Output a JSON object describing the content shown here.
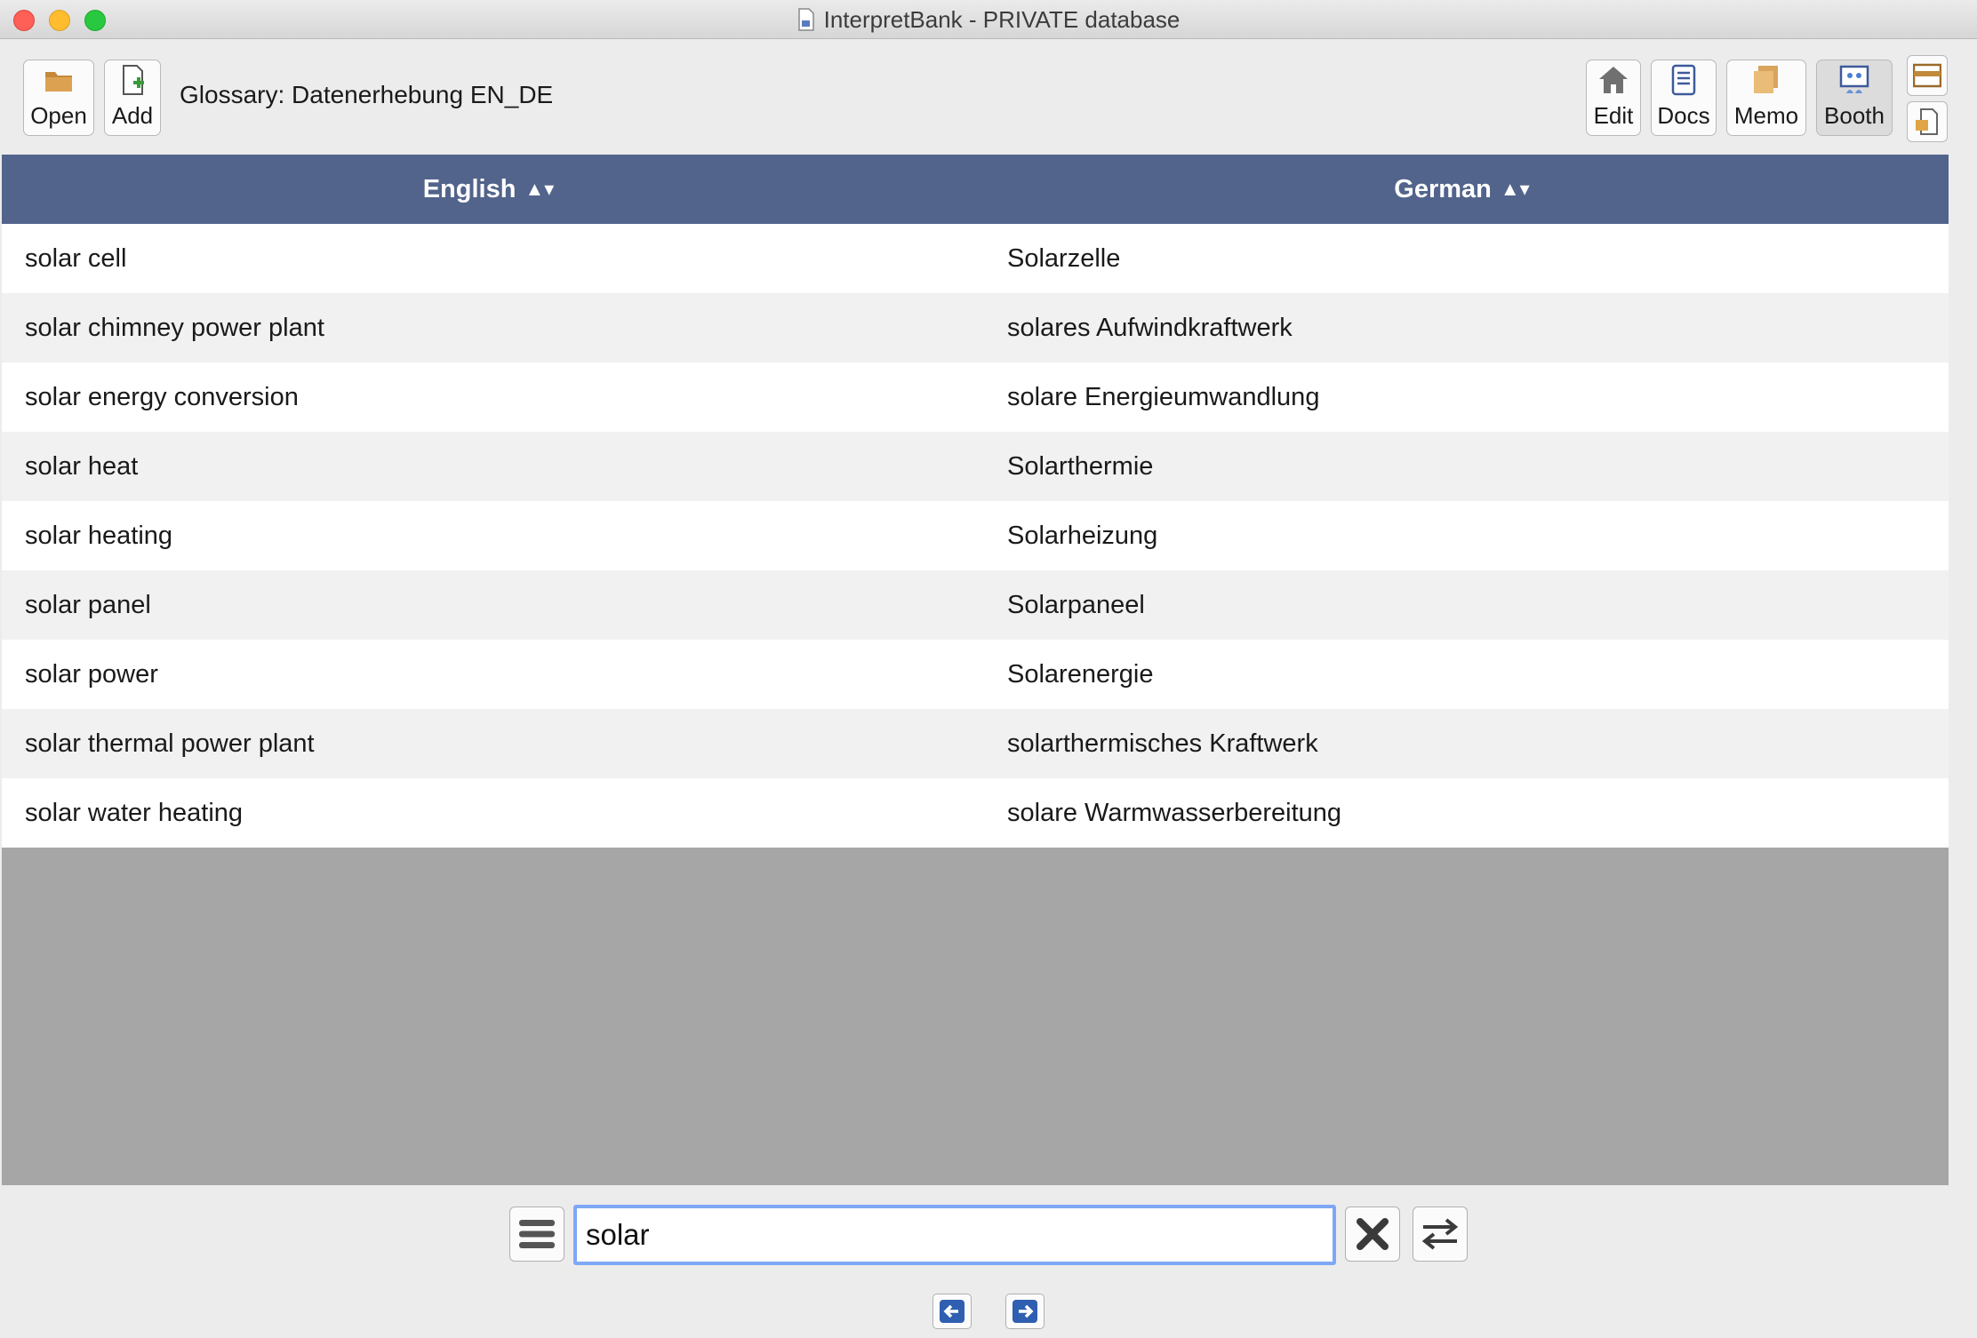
{
  "window": {
    "title": "InterpretBank - PRIVATE database"
  },
  "toolbar": {
    "open_label": "Open",
    "add_label": "Add",
    "glossary_label": "Glossary: Datenerhebung EN_DE",
    "edit_label": "Edit",
    "docs_label": "Docs",
    "memo_label": "Memo",
    "booth_label": "Booth"
  },
  "table": {
    "columns": [
      {
        "label": "English",
        "sort_glyph": "▲▾"
      },
      {
        "label": "German",
        "sort_glyph": "▲▾"
      }
    ],
    "rows": [
      {
        "en": "solar cell",
        "de": "Solarzelle"
      },
      {
        "en": "solar chimney power plant",
        "de": "solares Aufwindkraftwerk"
      },
      {
        "en": "solar energy conversion",
        "de": "solare Energieumwandlung"
      },
      {
        "en": "solar heat",
        "de": "Solarthermie"
      },
      {
        "en": "solar heating",
        "de": "Solarheizung"
      },
      {
        "en": "solar panel",
        "de": "Solarpaneel"
      },
      {
        "en": "solar power",
        "de": "Solarenergie"
      },
      {
        "en": "solar thermal power plant",
        "de": "solarthermisches Kraftwerk"
      },
      {
        "en": "solar water heating",
        "de": "solare Warmwasserbereitung"
      }
    ]
  },
  "search": {
    "value": "solar"
  },
  "colors": {
    "header_bg": "#52648b",
    "empty_area": "#a6a6a6",
    "focus_ring": "#7fa7f5"
  }
}
